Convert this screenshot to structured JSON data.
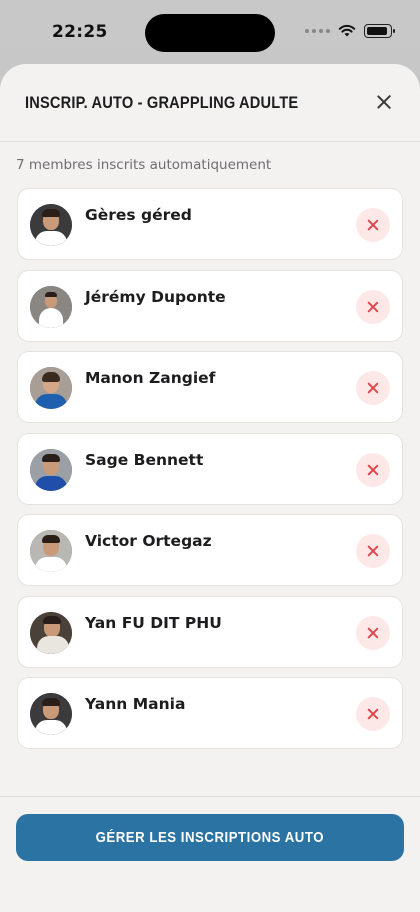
{
  "status_bar": {
    "time": "22:25"
  },
  "sheet": {
    "title": "INSCRIP. AUTO - GRAPPLING ADULTE",
    "count_label": "7 membres inscrits automatiquement",
    "members": [
      {
        "name": "Gères géred"
      },
      {
        "name": "Jérémy Duponte"
      },
      {
        "name": "Manon Zangief"
      },
      {
        "name": "Sage Bennett"
      },
      {
        "name": "Victor Ortegaz"
      },
      {
        "name": "Yan FU DIT PHU"
      },
      {
        "name": "Yann Mania"
      }
    ],
    "primary_button": "GÉRER LES INSCRIPTIONS AUTO"
  },
  "colors": {
    "accent": "#2b73a3",
    "remove_bg": "#fde8e8",
    "remove_icon": "#e0474c"
  }
}
